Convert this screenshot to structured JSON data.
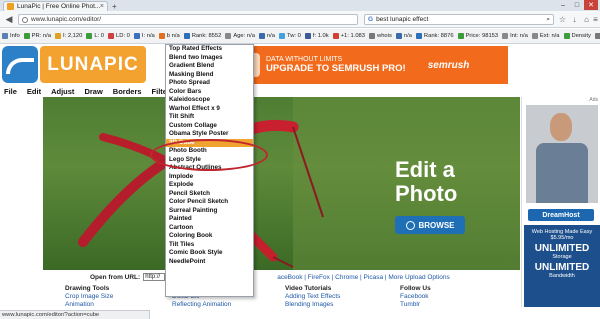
{
  "browser": {
    "tab_title": "LunaPic | Free Online Phot...",
    "tab_close": "×",
    "new_tab": "+",
    "url": "www.lunapic.com/editor/",
    "search_query": "best lunapic effect",
    "search_engine": "G"
  },
  "seo_toolbar": [
    {
      "label": "Info",
      "color": "#5a7fb0"
    },
    {
      "label": "PR: n/a",
      "color": "#3c9b3c"
    },
    {
      "label": "I: 2,120",
      "color": "#e0a020"
    },
    {
      "label": "L: 0",
      "color": "#3c9b3c"
    },
    {
      "label": "LD: 0",
      "color": "#d04040"
    },
    {
      "label": "I: n/a",
      "color": "#3c70c0"
    },
    {
      "label": "b n/a",
      "color": "#e07020"
    },
    {
      "label": "Rank: 8552",
      "color": "#2a6fb8"
    },
    {
      "label": "Age: n/a",
      "color": "#888888"
    },
    {
      "label": "n/a",
      "color": "#3a6aaa"
    },
    {
      "label": "Tw: 0",
      "color": "#45a0e0"
    },
    {
      "label": "f: 1.0k",
      "color": "#3a5a9a"
    },
    {
      "label": "+1: 1.083",
      "color": "#d04030"
    },
    {
      "label": "whois",
      "color": "#777777"
    },
    {
      "label": "n/a",
      "color": "#3a6aaa"
    },
    {
      "label": "Rank: 8876",
      "color": "#2a6fb8"
    },
    {
      "label": "Price: 98153",
      "color": "#3c9b3c"
    },
    {
      "label": "Int: n/a",
      "color": "#888888"
    },
    {
      "label": "Ext: n/a",
      "color": "#888888"
    },
    {
      "label": "Density",
      "color": "#3c9b3c"
    },
    {
      "label": "Diagnosis",
      "color": "#777777"
    }
  ],
  "header": {
    "logo_text": "LUNAPIC",
    "ad_line1": "DATA WITHOUT LIMITS",
    "ad_line2": "UPGRADE TO SEMRUSH PRO!",
    "ad_brand": "semrush"
  },
  "menubar": [
    "File",
    "Edit",
    "Adjust",
    "Draw",
    "Borders",
    "Filters"
  ],
  "dropdown": {
    "items": [
      "Top Rated Effects",
      "Blend two Images",
      "Gradient Blend",
      "Masking Blend",
      "Photo Spread",
      "Color Bars",
      "Kaleidoscope",
      "Warhol Effect x 9",
      "Tilt Shift",
      "Custom Collage",
      "Obama Style Poster",
      "3D Cube",
      "Photo Booth",
      "Lego Style",
      "Abstract Outlines",
      "Implode",
      "Explode",
      "Pencil Sketch",
      "Color Pencil Sketch",
      "Surreal Painting",
      "Painted",
      "Cartoon",
      "Coloring Book",
      "Tilt Tiles",
      "Comic Book Style",
      "NeedlePoint"
    ],
    "selected": "3D Cube"
  },
  "hero": {
    "edit_line1": "Edit a",
    "edit_line2": "Photo",
    "browse": "BROWSE"
  },
  "upload": {
    "label": "Open from URL:",
    "value": "http://",
    "links": "aceBook | FireFox | Chrome | Picasa | More Upload Options"
  },
  "right_ad": {
    "tag": "Ads",
    "brand": "DreamHost",
    "line1": "Web Hosting Made Easy $5.95/mo",
    "big1": "UNLIMITED",
    "sub1": "Storage",
    "big2": "UNLIMITED",
    "sub2": "Bandwidth"
  },
  "footer": {
    "col1": [
      "Drawing Tools",
      "Crop Image Size",
      "Animation"
    ],
    "col2": [
      "Effects and Filters",
      "Dollar Bill",
      "Reflecting Animation"
    ],
    "col3": [
      "Video Tutorials",
      "Adding Text Effects",
      "Blending Images"
    ],
    "col4_heading": "Follow Us",
    "col4": [
      "Facebook",
      "Tumblr"
    ]
  },
  "status_url": "www.lunapic.com/editor/?action=cube"
}
